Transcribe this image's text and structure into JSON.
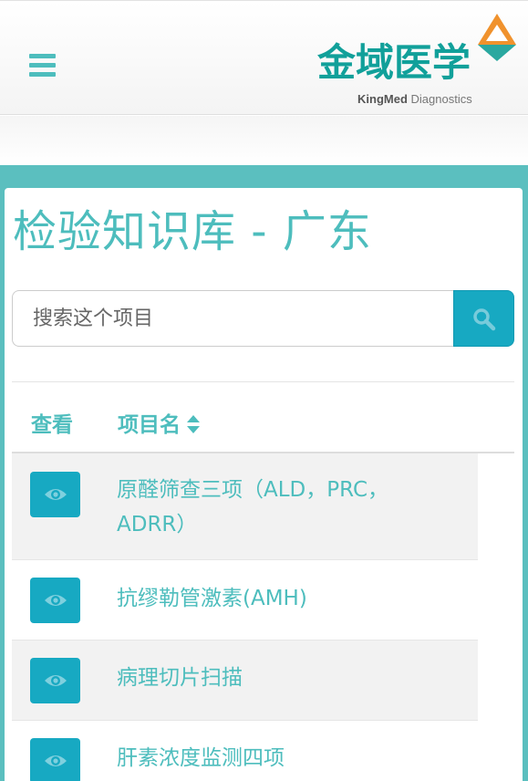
{
  "header": {
    "menu_icon": "hamburger-menu-icon",
    "logo": {
      "name_cn": "金域医学",
      "name_en_bold": "KingMed",
      "name_en_light": "Diagnostics",
      "colors": {
        "brand": "#11a09a",
        "mark_orange": "#f0922d",
        "mark_teal": "#2aa8a0"
      }
    }
  },
  "page": {
    "title": "检验知识库 - 广东"
  },
  "search": {
    "placeholder": "搜索这个项目",
    "value": "",
    "button_icon": "search-icon"
  },
  "table": {
    "columns": {
      "view": "查看",
      "name": "项目名"
    },
    "sort_icon": "sort-icon",
    "row_icon": "eye-icon",
    "rows": [
      {
        "name": "原醛筛查三项（ALD，PRC，ADRR）"
      },
      {
        "name": "抗缪勒管激素(AMH)"
      },
      {
        "name": "病理切片扫描"
      },
      {
        "name": "肝素浓度监测四项"
      }
    ]
  },
  "colors": {
    "accent": "#4dbdbd",
    "button": "#17a9c2",
    "frame": "#5bbfbf"
  }
}
